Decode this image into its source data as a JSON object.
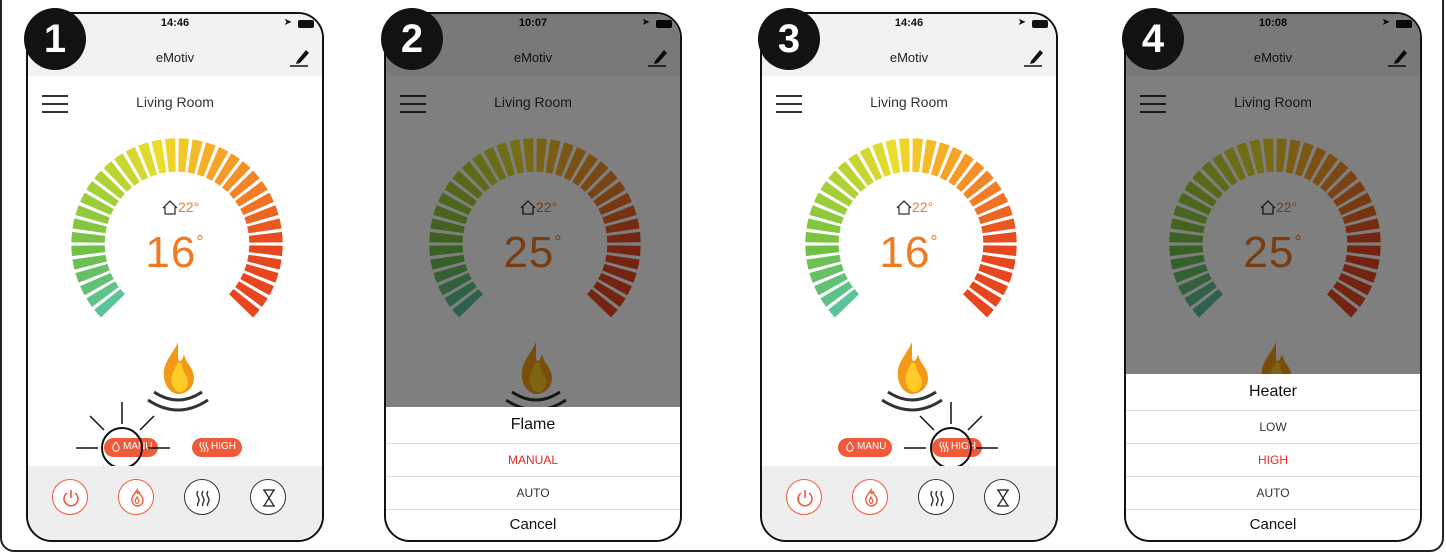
{
  "app_title": "eMotiv",
  "room": "Living Room",
  "colors": {
    "accent": "#ef7a22",
    "active_red": "#ef5a3a",
    "selected_option": "#e32b1e"
  },
  "setpoint_label": "22°",
  "icons": [
    "menu-icon",
    "edit-icon",
    "home-icon",
    "flame-logo",
    "power-icon",
    "flame-icon",
    "heat-icon",
    "timer-icon"
  ],
  "steps": [
    {
      "badge": "1",
      "time": "14:46",
      "temp": "16",
      "mode_label": "MANU",
      "heat_label": "HIGH"
    },
    {
      "badge": "2",
      "time": "10:07",
      "temp": "25",
      "sheet": {
        "title": "Flame",
        "options": [
          "MANUAL",
          "AUTO"
        ],
        "selected": "MANUAL",
        "cancel": "Cancel"
      }
    },
    {
      "badge": "3",
      "time": "14:46",
      "temp": "16",
      "mode_label": "MANU",
      "heat_label": "HIGH"
    },
    {
      "badge": "4",
      "time": "10:08",
      "temp": "25",
      "sheet": {
        "title": "Heater",
        "options": [
          "LOW",
          "HIGH",
          "AUTO"
        ],
        "selected": "HIGH",
        "cancel": "Cancel"
      }
    }
  ]
}
